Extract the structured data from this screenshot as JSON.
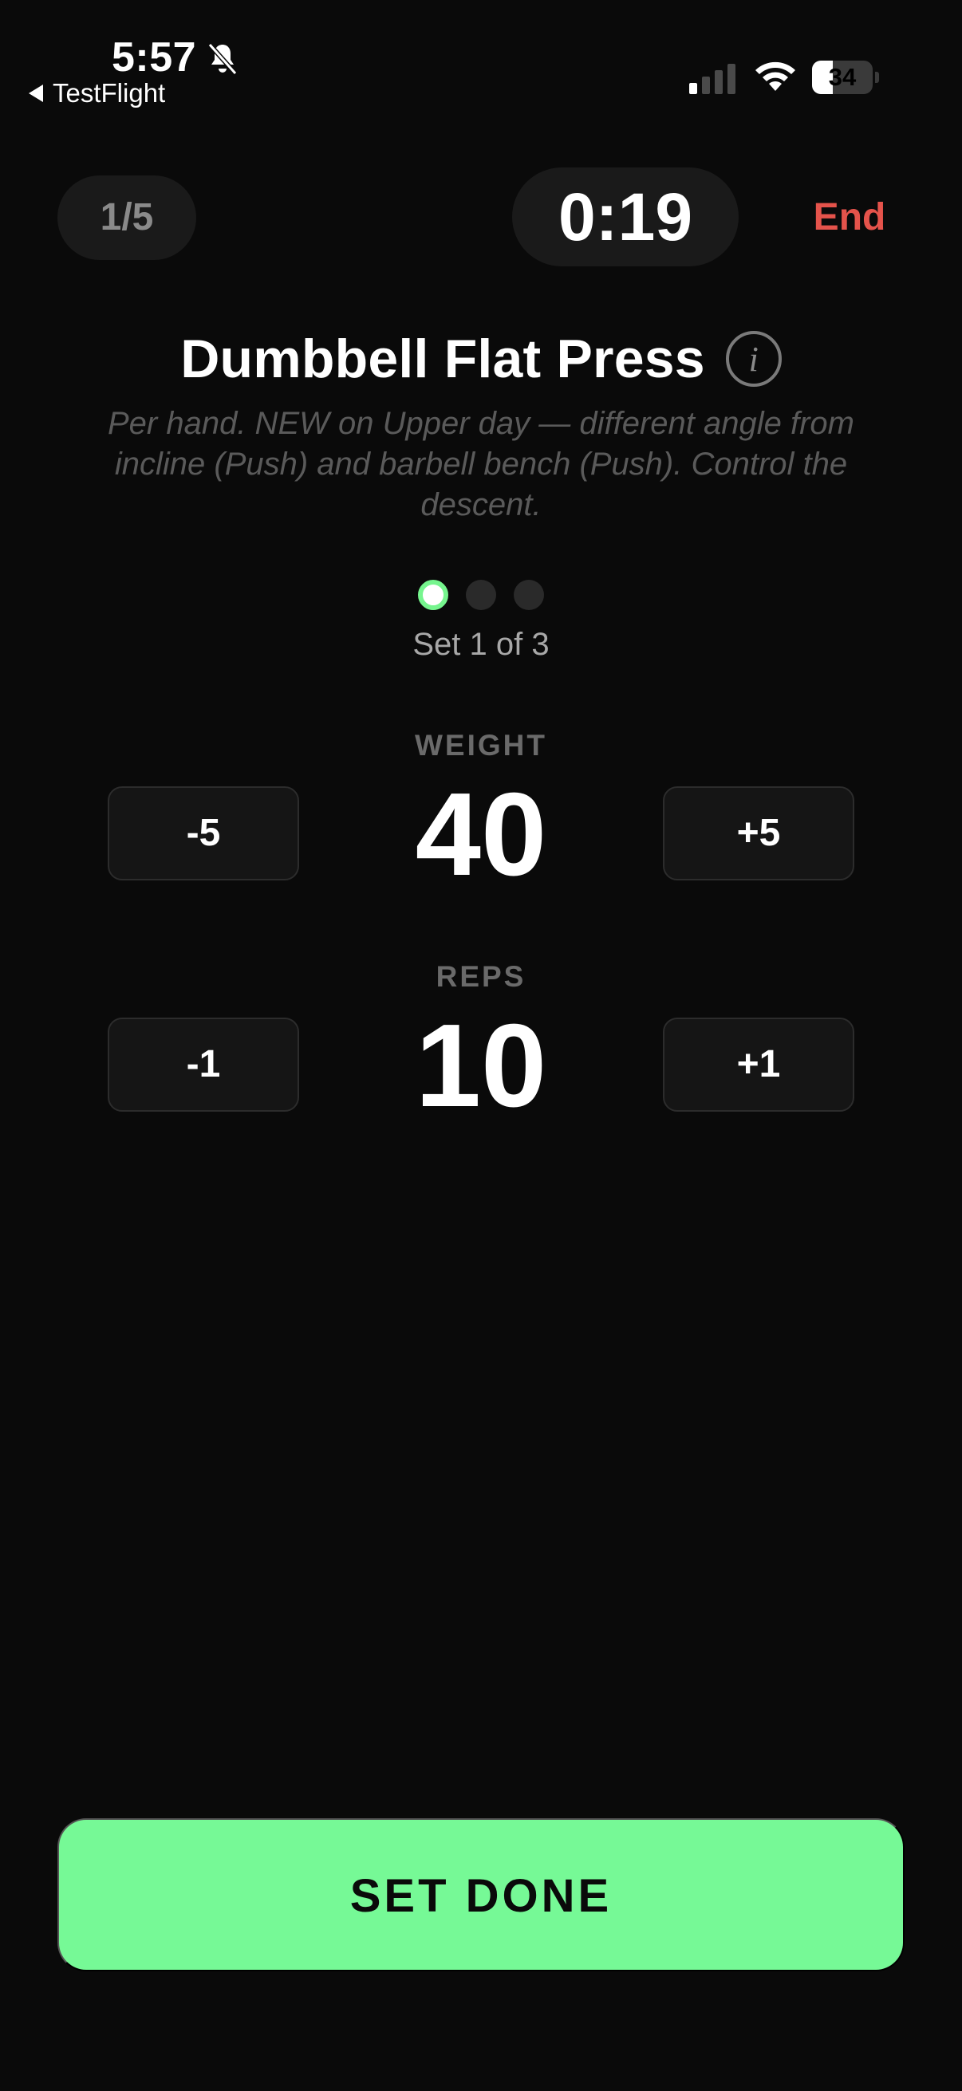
{
  "status_bar": {
    "time": "5:57",
    "back_app": "TestFlight",
    "battery_level": "34",
    "battery_fraction": 0.34,
    "signal_bars_active": 1,
    "signal_bars_total": 4
  },
  "header": {
    "exercise_counter": "1/5",
    "timer": "0:19",
    "end_label": "End"
  },
  "exercise": {
    "title": "Dumbbell Flat Press",
    "info_icon": "i",
    "notes": "Per hand. NEW on Upper day — different angle from incline (Push) and barbell bench (Push). Control the descent."
  },
  "sets": {
    "current": 1,
    "total": 3,
    "label": "Set 1 of 3"
  },
  "weight": {
    "label": "WEIGHT",
    "value": "40",
    "decrement_label": "-5",
    "increment_label": "+5"
  },
  "reps": {
    "label": "REPS",
    "value": "10",
    "decrement_label": "-1",
    "increment_label": "+1"
  },
  "action": {
    "set_done_label": "SET DONE"
  },
  "colors": {
    "background": "#0a0a0a",
    "accent_green": "#76f996",
    "end_red": "#e5534b",
    "pill_bg": "#1a1a1a"
  }
}
